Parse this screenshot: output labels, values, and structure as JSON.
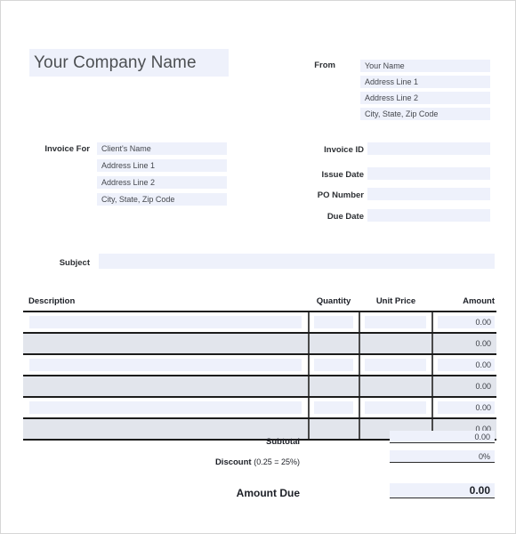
{
  "document": {
    "type": "invoice-template",
    "company_name": "Your Company Name"
  },
  "from": {
    "label": "From",
    "lines": [
      "Your Name",
      "Address Line 1",
      "Address Line 2",
      "City, State, Zip Code"
    ]
  },
  "invoice_for": {
    "label": "Invoice For",
    "lines": [
      "Client's Name",
      "Address Line 1",
      "Address Line 2",
      "City, State, Zip Code"
    ]
  },
  "meta": {
    "fields": [
      {
        "label": "Invoice ID",
        "value": ""
      },
      {
        "label": "Issue Date",
        "value": ""
      },
      {
        "label": "PO Number",
        "value": ""
      },
      {
        "label": "Due Date",
        "value": ""
      }
    ]
  },
  "subject": {
    "label": "Subject",
    "value": ""
  },
  "items_table": {
    "columns": [
      "Description",
      "Quantity",
      "Unit Price",
      "Amount"
    ],
    "rows": [
      {
        "description": "",
        "quantity": "",
        "unit_price": "",
        "amount": "0.00"
      },
      {
        "description": "",
        "quantity": "",
        "unit_price": "",
        "amount": "0.00"
      },
      {
        "description": "",
        "quantity": "",
        "unit_price": "",
        "amount": "0.00"
      },
      {
        "description": "",
        "quantity": "",
        "unit_price": "",
        "amount": "0.00"
      },
      {
        "description": "",
        "quantity": "",
        "unit_price": "",
        "amount": "0.00"
      },
      {
        "description": "",
        "quantity": "",
        "unit_price": "",
        "amount": "0.00"
      }
    ]
  },
  "totals": {
    "subtotal_label": "Subtotal",
    "subtotal_value": "0.00",
    "discount_label": "Discount",
    "discount_note": "(0.25 = 25%)",
    "discount_value": "0%",
    "amount_due_label": "Amount Due",
    "amount_due_value": "0.00"
  },
  "colors": {
    "field_blue": "#eef1fb",
    "row_gray": "#e2e5ec",
    "rule": "#1c1c1c",
    "text": "#1c1f26",
    "page_border": "#d6d6d6"
  }
}
